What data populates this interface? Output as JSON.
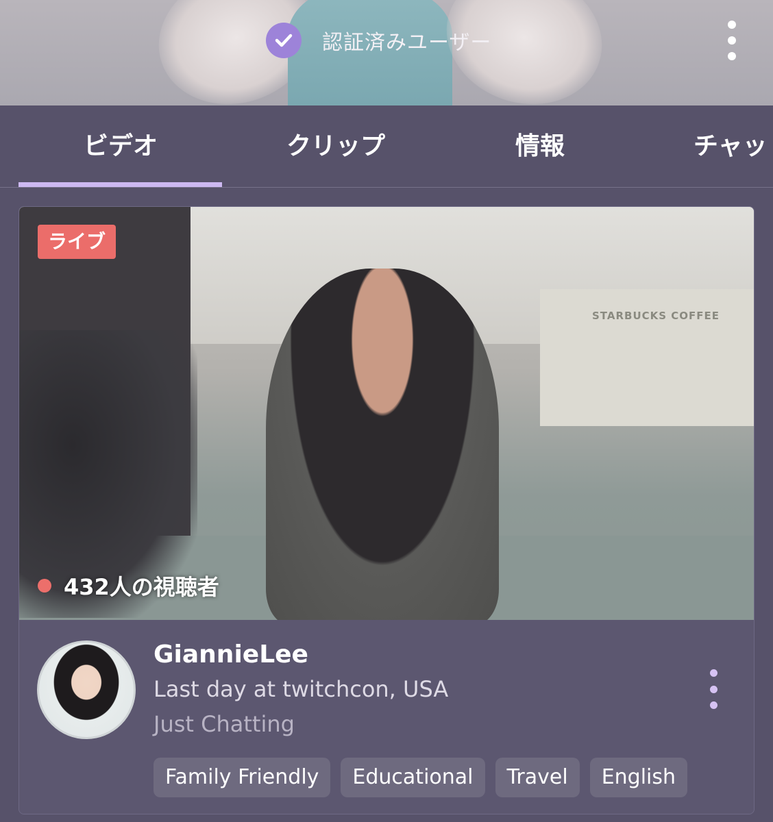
{
  "header": {
    "verified_label": "認証済みユーザー",
    "verified_icon": "check-badge-icon",
    "menu_icon": "more-vertical-icon"
  },
  "tabs": [
    {
      "label": "ビデオ",
      "active": true
    },
    {
      "label": "クリップ",
      "active": false
    },
    {
      "label": "情報",
      "active": false
    },
    {
      "label": "チャッ",
      "active": false
    }
  ],
  "stream": {
    "live_badge": "ライブ",
    "viewers": "432人の視聴者",
    "streamer": "GiannieLee",
    "title": "Last day at twitchcon, USA",
    "category": "Just Chatting",
    "thumbnail_sign": "STARBUCKS COFFEE",
    "tags": [
      "Family Friendly",
      "Educational",
      "Travel",
      "English"
    ]
  },
  "colors": {
    "accent": "#9d83d9",
    "tab_underline": "#cdb9f2",
    "live_red": "#eb6d6a",
    "background": "#57526a"
  }
}
